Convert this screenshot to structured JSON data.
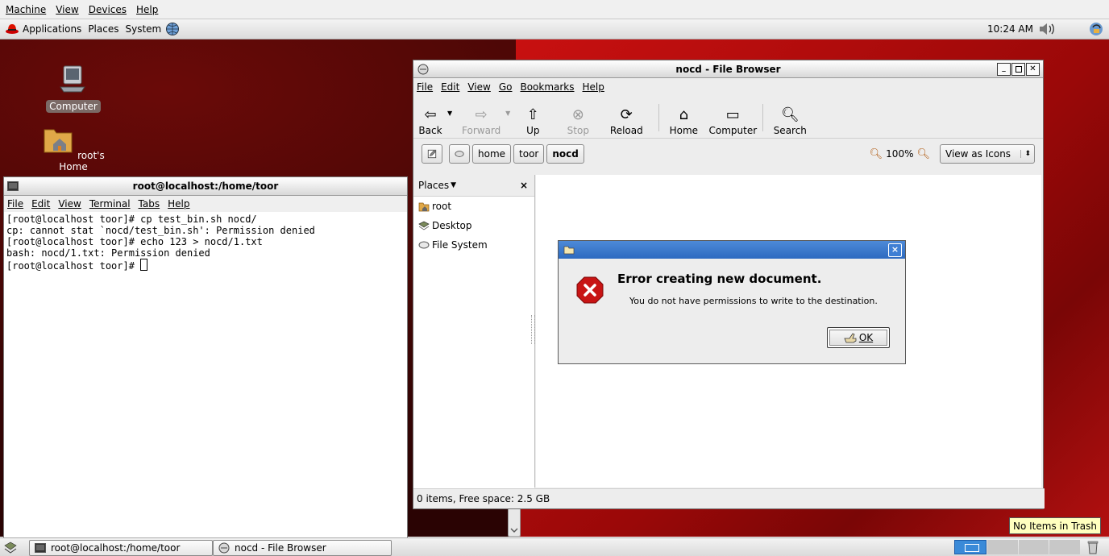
{
  "vm_menu": [
    "Machine",
    "View",
    "Devices",
    "Help"
  ],
  "top_panel": {
    "applications": "Applications",
    "places": "Places",
    "system": "System",
    "clock": "10:24 AM"
  },
  "desktop": {
    "icons": [
      {
        "label": "Computer"
      },
      {
        "label": "root's Home"
      }
    ]
  },
  "terminal": {
    "title": "root@localhost:/home/toor",
    "menu": [
      "File",
      "Edit",
      "View",
      "Terminal",
      "Tabs",
      "Help"
    ],
    "lines": [
      "[root@localhost toor]# cp test_bin.sh nocd/",
      "cp: cannot stat `nocd/test_bin.sh': Permission denied",
      "[root@localhost toor]# echo 123 > nocd/1.txt",
      "bash: nocd/1.txt: Permission denied",
      "[root@localhost toor]# "
    ]
  },
  "file_browser": {
    "title": "nocd - File Browser",
    "menu": [
      "File",
      "Edit",
      "View",
      "Go",
      "Bookmarks",
      "Help"
    ],
    "toolbar": {
      "back": "Back",
      "forward": "Forward",
      "up": "Up",
      "stop": "Stop",
      "reload": "Reload",
      "home": "Home",
      "computer": "Computer",
      "search": "Search"
    },
    "path": [
      "home",
      "toor",
      "nocd"
    ],
    "zoom": "100%",
    "view_mode": "View as Icons",
    "places_header": "Places",
    "places": [
      "root",
      "Desktop",
      "File System"
    ],
    "status": "0 items, Free space: 2.5 GB"
  },
  "dialog": {
    "heading": "Error creating new document.",
    "message": "You do not have permissions to write to the destination.",
    "ok": "OK"
  },
  "bottom_panel": {
    "tasks": [
      "root@localhost:/home/toor",
      "nocd - File Browser"
    ],
    "trash_tooltip": "No Items in Trash"
  },
  "colors": {
    "desktop_red": "#b00c0c",
    "dialog_title_blue": "#2d6ac0",
    "error_red": "#c81414"
  }
}
